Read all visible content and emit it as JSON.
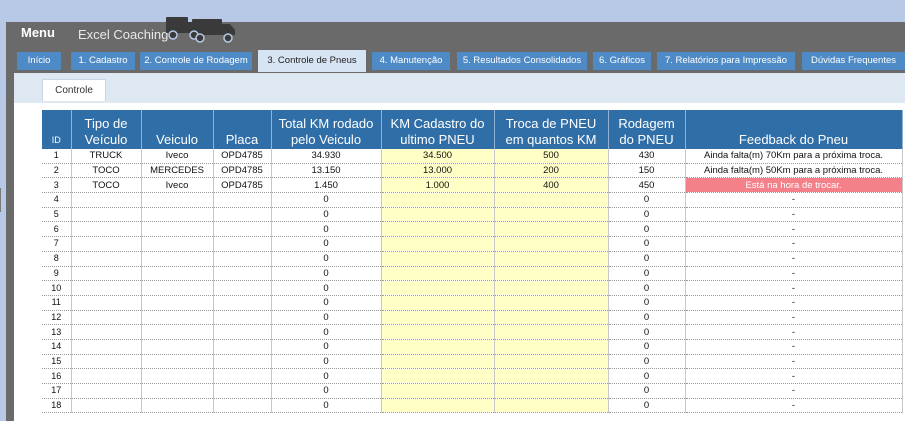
{
  "app": {
    "menu_label": "Menu",
    "brand": "Excel Coaching",
    "truck_icon": "trucks-icon"
  },
  "tabs": [
    {
      "label": "Início",
      "active": false
    },
    {
      "label": "1. Cadastro",
      "active": false
    },
    {
      "label": "2. Controle de Rodagem",
      "active": false
    },
    {
      "label": "3. Controle de Pneus",
      "active": true
    },
    {
      "label": "4. Manutenção",
      "active": false
    },
    {
      "label": "5. Resultados Consolidados",
      "active": false
    },
    {
      "label": "6. Gráficos",
      "active": false
    },
    {
      "label": "7. Relatórios para Impressão",
      "active": false
    },
    {
      "label": "Dúvidas Frequentes",
      "active": false
    }
  ],
  "subtab": {
    "label": "Controle"
  },
  "table": {
    "headers": [
      "ID",
      "Tipo de Veículo",
      "Veiculo",
      "Placa",
      "Total KM rodado pelo Veiculo",
      "KM Cadastro do ultimo PNEU",
      "Troca de PNEU em quantos KM",
      "Rodagem do PNEU",
      "Feedback do Pneu"
    ],
    "rows": [
      [
        "1",
        "TRUCK",
        "Iveco",
        "OPD4785",
        "34.930",
        "34.500",
        "500",
        "430",
        "Ainda falta(m) 70Km para a próxima troca."
      ],
      [
        "2",
        "TOCO",
        "MERCEDES",
        "OPD4785",
        "13.150",
        "13.000",
        "200",
        "150",
        "Ainda falta(m) 50Km para a próxima troca."
      ],
      [
        "3",
        "TOCO",
        "Iveco",
        "OPD4785",
        "1.450",
        "1.000",
        "400",
        "450",
        "Está na hora de trocar."
      ],
      [
        "4",
        "",
        "",
        "",
        "0",
        "",
        "",
        "0",
        "-"
      ],
      [
        "5",
        "",
        "",
        "",
        "0",
        "",
        "",
        "0",
        "-"
      ],
      [
        "6",
        "",
        "",
        "",
        "0",
        "",
        "",
        "0",
        "-"
      ],
      [
        "7",
        "",
        "",
        "",
        "0",
        "",
        "",
        "0",
        "-"
      ],
      [
        "8",
        "",
        "",
        "",
        "0",
        "",
        "",
        "0",
        "-"
      ],
      [
        "9",
        "",
        "",
        "",
        "0",
        "",
        "",
        "0",
        "-"
      ],
      [
        "10",
        "",
        "",
        "",
        "0",
        "",
        "",
        "0",
        "-"
      ],
      [
        "11",
        "",
        "",
        "",
        "0",
        "",
        "",
        "0",
        "-"
      ],
      [
        "12",
        "",
        "",
        "",
        "0",
        "",
        "",
        "0",
        "-"
      ],
      [
        "13",
        "",
        "",
        "",
        "0",
        "",
        "",
        "0",
        "-"
      ],
      [
        "14",
        "",
        "",
        "",
        "0",
        "",
        "",
        "0",
        "-"
      ],
      [
        "15",
        "",
        "",
        "",
        "0",
        "",
        "",
        "0",
        "-"
      ],
      [
        "16",
        "",
        "",
        "",
        "0",
        "",
        "",
        "0",
        "-"
      ],
      [
        "17",
        "",
        "",
        "",
        "0",
        "",
        "",
        "0",
        "-"
      ],
      [
        "18",
        "",
        "",
        "",
        "0",
        "",
        "",
        "0",
        "-"
      ]
    ],
    "alert_color": "#f4808a",
    "input_color": "#ffffc6",
    "header_color": "#2f6ea6"
  }
}
